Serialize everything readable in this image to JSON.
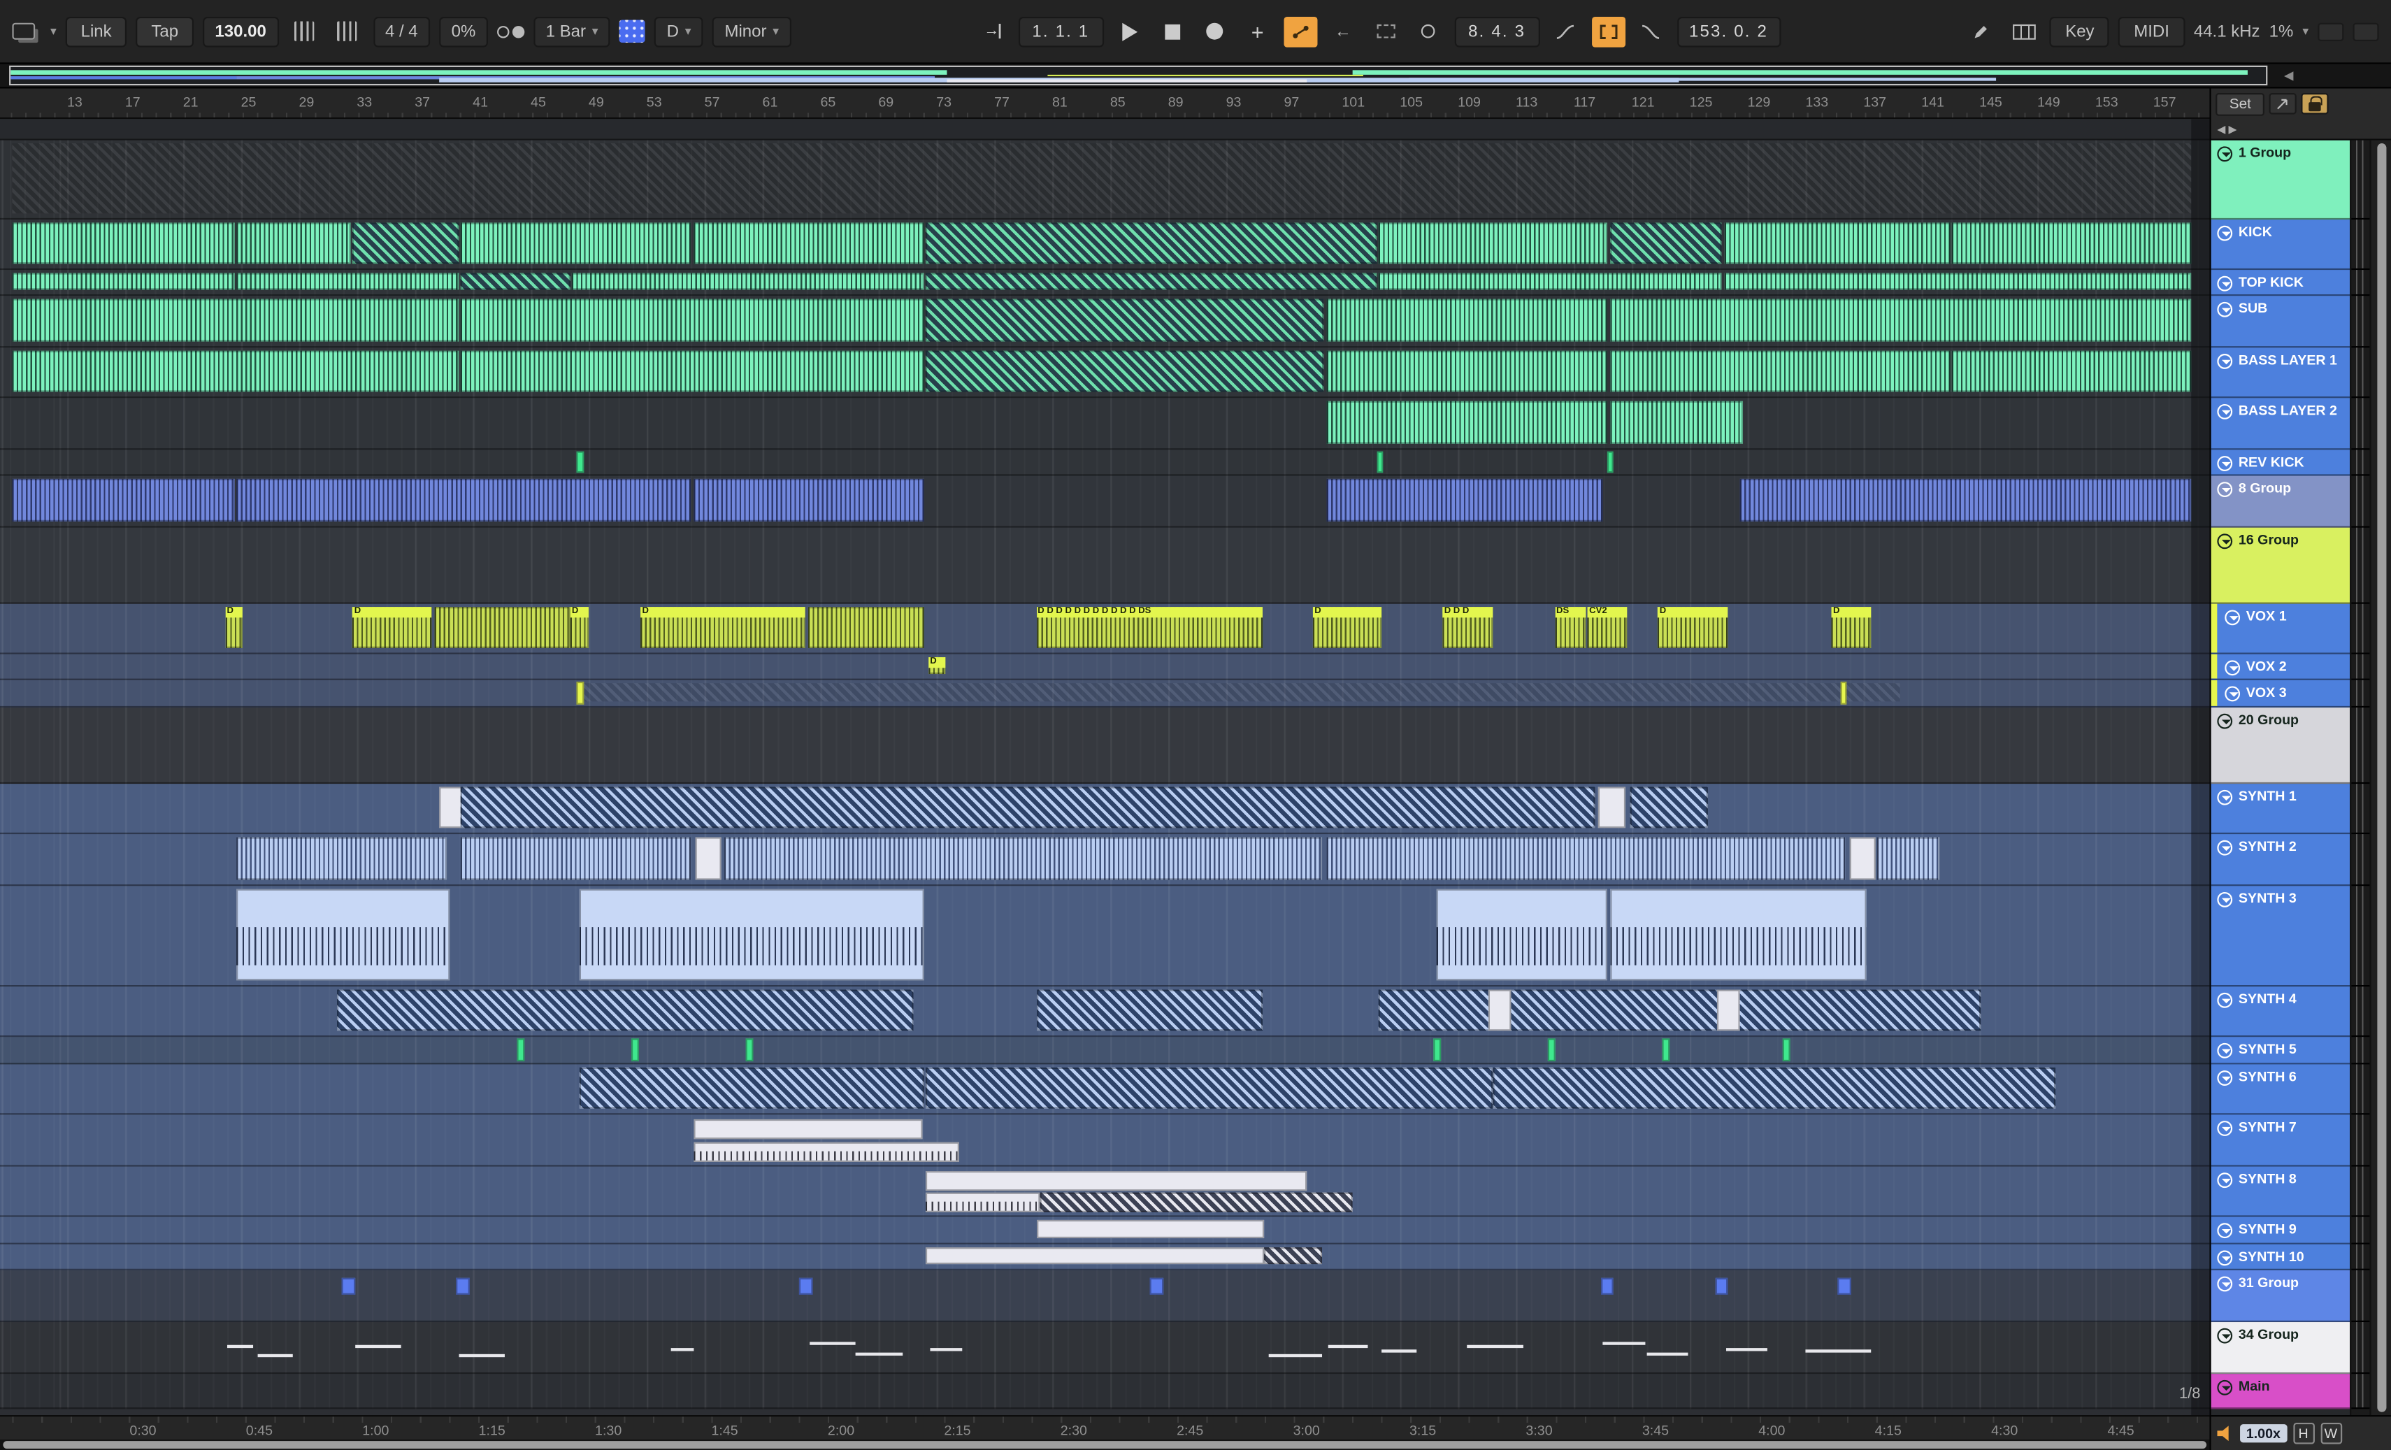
{
  "toolbar": {
    "link": "Link",
    "tap": "Tap",
    "tempo": "130.00",
    "time_signature": "4 / 4",
    "groove": "0%",
    "quantize": "1 Bar",
    "scale_root": "D",
    "scale_name": "Minor",
    "position": "1.  1.  1",
    "punch_time": "8.  4.  3",
    "loop_point": "153.  0.  2",
    "key": "Key",
    "midi": "MIDI",
    "sample_rate": "44.1 kHz",
    "cpu": "1%"
  },
  "ruler": {
    "set": "Set",
    "bars": [
      "13",
      "17",
      "21",
      "25",
      "29",
      "33",
      "37",
      "41",
      "45",
      "49",
      "53",
      "57",
      "61",
      "65",
      "69",
      "73",
      "77",
      "81",
      "85",
      "89",
      "93",
      "97",
      "101",
      "105",
      "109",
      "113",
      "117",
      "121",
      "125",
      "129",
      "133",
      "137",
      "141",
      "145",
      "149",
      "153",
      "157"
    ]
  },
  "time_ruler": {
    "labels": [
      "0:30",
      "0:45",
      "1:00",
      "1:15",
      "1:30",
      "1:45",
      "2:00",
      "2:15",
      "2:30",
      "2:45",
      "3:00",
      "3:15",
      "3:30",
      "3:45",
      "4:00",
      "4:15",
      "4:30",
      "4:45"
    ]
  },
  "status_bar": {
    "grid_value": "1/8",
    "speed": "1.00x",
    "h": "H",
    "w": "W"
  },
  "colors": {
    "accent_orange": "#f0a340",
    "mint": "#7df2be",
    "track_blue": "#4d80dd",
    "light_blue": "#b9cdf2",
    "vox_yellow": "#d9ee4e",
    "magenta": "#d84fc8"
  },
  "overview": {
    "segments": [
      {
        "s": 0,
        "w": 41.5,
        "y": 16,
        "h": 28,
        "c": "#7df2be"
      },
      {
        "s": 59.5,
        "w": 39.7,
        "y": 16,
        "h": 28,
        "c": "#7df2be"
      },
      {
        "s": 0,
        "w": 10,
        "y": 50,
        "h": 26,
        "c": "#5b7ce0"
      },
      {
        "s": 10,
        "w": 31,
        "y": 50,
        "h": 20,
        "c": "#6e86dd"
      },
      {
        "s": 46,
        "w": 14,
        "y": 44,
        "h": 12,
        "c": "#d8ee55"
      },
      {
        "s": 19,
        "w": 55,
        "y": 62,
        "h": 26,
        "c": "#b9cdf2"
      },
      {
        "s": 41.5,
        "w": 16,
        "y": 70,
        "h": 22,
        "c": "#e9e9f0"
      },
      {
        "s": 62,
        "w": 26,
        "y": 62,
        "h": 22,
        "c": "#b9cdf2"
      }
    ]
  },
  "tracks": [
    {
      "name": "1 Group",
      "kind": "group",
      "h": 52,
      "header": "#7ff0bd",
      "lane": "#2f3236",
      "dark": true,
      "clips": [
        {
          "t": "hatch-dark",
          "s": 0,
          "w": 99.2
        }
      ]
    },
    {
      "name": "KICK",
      "kind": "audio",
      "h": 33,
      "header": "#4d80dd",
      "lane": "#303439",
      "clips": [
        {
          "t": "wave-green",
          "s": 0,
          "w": 10.1
        },
        {
          "t": "wave-green",
          "s": 10.2,
          "w": 5.2
        },
        {
          "t": "hatch-green",
          "s": 15.5,
          "w": 4.8
        },
        {
          "t": "wave-green",
          "s": 20.4,
          "w": 10.5
        },
        {
          "t": "wave-green",
          "s": 31,
          "w": 10.5
        },
        {
          "t": "hatch-green",
          "s": 41.6,
          "w": 20.5
        },
        {
          "t": "wave-green",
          "s": 62.2,
          "w": 10.4
        },
        {
          "t": "hatch-green",
          "s": 72.7,
          "w": 5.1
        },
        {
          "t": "wave-green",
          "s": 77.9,
          "w": 10.3
        },
        {
          "t": "wave-green",
          "s": 88.3,
          "w": 10.9
        }
      ]
    },
    {
      "name": "TOP KICK",
      "kind": "audio",
      "h": 17,
      "header": "#4d80dd",
      "lane": "#303439",
      "clips": [
        {
          "t": "wave-green",
          "s": 0,
          "w": 10.1
        },
        {
          "t": "wave-green",
          "s": 10.2,
          "w": 10.1
        },
        {
          "t": "hatch-green",
          "s": 20.4,
          "w": 5
        },
        {
          "t": "wave-green",
          "s": 25.5,
          "w": 16
        },
        {
          "t": "hatch-green",
          "s": 41.6,
          "w": 20.5
        },
        {
          "t": "wave-green",
          "s": 62.2,
          "w": 15.6
        },
        {
          "t": "wave-green",
          "s": 77.9,
          "w": 21.3
        }
      ]
    },
    {
      "name": "SUB",
      "kind": "audio",
      "h": 34,
      "header": "#4d80dd",
      "lane": "#303439",
      "clips": [
        {
          "t": "wave-green",
          "s": 0,
          "w": 20.3
        },
        {
          "t": "wave-green",
          "s": 20.4,
          "w": 21.1
        },
        {
          "t": "hatch-green",
          "s": 41.6,
          "w": 18.1
        },
        {
          "t": "wave-green",
          "s": 59.8,
          "w": 12.8
        },
        {
          "t": "wave-green",
          "s": 72.7,
          "w": 26.5
        }
      ]
    },
    {
      "name": "BASS LAYER 1",
      "kind": "audio",
      "h": 33,
      "header": "#4d80dd",
      "lane": "#303439",
      "clips": [
        {
          "t": "wave-green",
          "s": 0,
          "w": 20.3
        },
        {
          "t": "wave-green",
          "s": 20.4,
          "w": 21.1
        },
        {
          "t": "hatch-green",
          "s": 41.6,
          "w": 18.1
        },
        {
          "t": "wave-green",
          "s": 59.8,
          "w": 12.8
        },
        {
          "t": "wave-green",
          "s": 72.7,
          "w": 15.5
        },
        {
          "t": "wave-green",
          "s": 88.3,
          "w": 10.9
        }
      ]
    },
    {
      "name": "BASS LAYER 2",
      "kind": "audio",
      "h": 34,
      "header": "#4d80dd",
      "lane": "#303439",
      "clips": [
        {
          "t": "wave-green",
          "s": 59.8,
          "w": 12.8
        },
        {
          "t": "wave-green",
          "s": 72.7,
          "w": 6.1
        }
      ]
    },
    {
      "name": "REV KICK",
      "kind": "audio",
      "h": 17,
      "header": "#4d80dd",
      "lane": "#303439",
      "clips": [
        {
          "t": "mark-green",
          "s": 25.7,
          "w": 0.3
        },
        {
          "t": "mark-green",
          "s": 62.1,
          "w": 0.3
        },
        {
          "t": "mark-green",
          "s": 72.6,
          "w": 0.3
        }
      ]
    },
    {
      "name": "8 Group",
      "kind": "group",
      "h": 34,
      "header": "#8393c6",
      "lane": "#31353b",
      "clips": [
        {
          "t": "wave-peri",
          "s": 0,
          "w": 10.1
        },
        {
          "t": "wave-peri",
          "s": 10.2,
          "w": 20.7
        },
        {
          "t": "wave-peri",
          "s": 31,
          "w": 10.5
        },
        {
          "t": "wave-peri",
          "s": 59.8,
          "w": 12.6
        },
        {
          "t": "wave-peri",
          "s": 78.6,
          "w": 20.6
        }
      ]
    },
    {
      "name": "16 Group",
      "kind": "group",
      "h": 50,
      "header": "#d9f060",
      "lane": "#34383e",
      "dark": true,
      "clips": []
    },
    {
      "name": "VOX 1",
      "kind": "audio",
      "h": 33,
      "header": "#4d80dd",
      "lane": "#46536f",
      "strip": true,
      "clips": [
        {
          "t": "vox",
          "s": 9.7,
          "w": 0.8,
          "label": "D"
        },
        {
          "t": "vox",
          "s": 15.5,
          "w": 3.6,
          "label": "D"
        },
        {
          "t": "vox",
          "s": 19.2,
          "w": 6.2
        },
        {
          "t": "vox",
          "s": 25.4,
          "w": 0.8,
          "label": "D"
        },
        {
          "t": "vox",
          "s": 28.6,
          "w": 7.5,
          "label": "D"
        },
        {
          "t": "vox",
          "s": 36.2,
          "w": 5.3
        },
        {
          "t": "vox",
          "s": 46.6,
          "w": 10.3,
          "label": "D D D D D D D D D D D DS"
        },
        {
          "t": "vox",
          "s": 59.2,
          "w": 3.1,
          "label": "D"
        },
        {
          "t": "vox",
          "s": 65.1,
          "w": 2.3,
          "label": "D D D"
        },
        {
          "t": "vox",
          "s": 70.2,
          "w": 1.4,
          "label": "DS"
        },
        {
          "t": "vox",
          "s": 71.7,
          "w": 1.8,
          "label": "CV2"
        },
        {
          "t": "vox",
          "s": 74.9,
          "w": 3.2,
          "label": "D"
        },
        {
          "t": "vox",
          "s": 82.8,
          "w": 1.8,
          "label": "D"
        }
      ]
    },
    {
      "name": "VOX 2",
      "kind": "audio",
      "h": 17,
      "header": "#4d80dd",
      "lane": "#46536f",
      "strip": true,
      "clips": [
        {
          "t": "vox",
          "s": 41.7,
          "w": 0.8,
          "label": "D"
        }
      ]
    },
    {
      "name": "VOX 3",
      "kind": "audio",
      "h": 18,
      "header": "#4d80dd",
      "lane": "#46536f",
      "strip": true,
      "clips": [
        {
          "t": "hatch-dark",
          "s": 25.7,
          "w": 60.2
        },
        {
          "t": "mark-yellow",
          "s": 25.7,
          "w": 0.3
        },
        {
          "t": "mark-yellow",
          "s": 83.2,
          "w": 0.3
        }
      ]
    },
    {
      "name": "20 Group",
      "kind": "group",
      "h": 50,
      "header": "#d6d6db",
      "lane": "#36393f",
      "dark": true,
      "clips": []
    },
    {
      "name": "SYNTH 1",
      "kind": "midi",
      "h": 33,
      "header": "#4d80dd",
      "lane": "#4b5d81",
      "clips": [
        {
          "t": "white",
          "s": 19.4,
          "w": 1.2
        },
        {
          "t": "hatch-lblue",
          "s": 20.4,
          "w": 51.6
        },
        {
          "t": "white",
          "s": 72.2,
          "w": 1.2
        },
        {
          "t": "hatch-lblue",
          "s": 73.6,
          "w": 3.6
        }
      ]
    },
    {
      "name": "SYNTH 2",
      "kind": "midi",
      "h": 34,
      "header": "#4d80dd",
      "lane": "#4b5d81",
      "clips": [
        {
          "t": "wave-lblue",
          "s": 10.2,
          "w": 9.6
        },
        {
          "t": "wave-lblue",
          "s": 20.4,
          "w": 10.5
        },
        {
          "t": "white",
          "s": 31.1,
          "w": 1.2
        },
        {
          "t": "wave-lblue",
          "s": 32.4,
          "w": 27.2
        },
        {
          "t": "wave-lblue",
          "s": 59.8,
          "w": 23.6
        },
        {
          "t": "white",
          "s": 83.6,
          "w": 1.2
        },
        {
          "t": "wave-lblue",
          "s": 84.9,
          "w": 2.8
        }
      ]
    },
    {
      "name": "SYNTH 3",
      "kind": "midi",
      "h": 66,
      "header": "#4d80dd",
      "lane": "#4b5d81",
      "clips": [
        {
          "t": "midi-lblue",
          "s": 10.2,
          "w": 9.7
        },
        {
          "t": "midi-lblue",
          "s": 25.8,
          "w": 15.7
        },
        {
          "t": "midi-lblue",
          "s": 64.8,
          "w": 7.8
        },
        {
          "t": "midi-lblue",
          "s": 72.7,
          "w": 11.7
        }
      ]
    },
    {
      "name": "SYNTH 4",
      "kind": "midi",
      "h": 33,
      "header": "#4d80dd",
      "lane": "#4b5d81",
      "clips": [
        {
          "t": "hatch-lblue",
          "s": 14.8,
          "w": 26.2
        },
        {
          "t": "hatch-lblue",
          "s": 46.6,
          "w": 10.3
        },
        {
          "t": "hatch-lblue",
          "s": 62.2,
          "w": 27.4
        },
        {
          "t": "white",
          "s": 67.2,
          "w": 1
        },
        {
          "t": "white",
          "s": 77.6,
          "w": 1
        }
      ]
    },
    {
      "name": "SYNTH 5",
      "kind": "midi",
      "h": 18,
      "header": "#4d80dd",
      "lane": "#44546f",
      "clips": [
        {
          "t": "mark-green",
          "s": 23,
          "w": 0.3
        },
        {
          "t": "mark-green",
          "s": 28.2,
          "w": 0.3
        },
        {
          "t": "mark-green",
          "s": 33.4,
          "w": 0.3
        },
        {
          "t": "mark-green",
          "s": 64.7,
          "w": 0.3
        },
        {
          "t": "mark-green",
          "s": 69.9,
          "w": 0.3
        },
        {
          "t": "mark-green",
          "s": 75.1,
          "w": 0.3
        },
        {
          "t": "mark-green",
          "s": 80.6,
          "w": 0.3
        }
      ]
    },
    {
      "name": "SYNTH 6",
      "kind": "midi",
      "h": 33,
      "header": "#4d80dd",
      "lane": "#4b5d81",
      "clips": [
        {
          "t": "hatch-lblue",
          "s": 25.8,
          "w": 15.7
        },
        {
          "t": "hatch-lblue",
          "s": 41.6,
          "w": 25.8
        },
        {
          "t": "hatch-lblue",
          "s": 67.4,
          "w": 25.6
        }
      ]
    },
    {
      "name": "SYNTH 7",
      "kind": "midi",
      "h": 34,
      "header": "#4d80dd",
      "lane": "#4b5d81",
      "clips": [
        {
          "t": "white",
          "s": 31,
          "w": 10.4,
          "lane": "top"
        },
        {
          "t": "midi-white",
          "s": 31,
          "w": 12.1,
          "lane": "bottom"
        }
      ]
    },
    {
      "name": "SYNTH 8",
      "kind": "midi",
      "h": 33,
      "header": "#4d80dd",
      "lane": "#4b5d81",
      "clips": [
        {
          "t": "white",
          "s": 41.6,
          "w": 17.3,
          "lane": "top"
        },
        {
          "t": "midi-white",
          "s": 41.6,
          "w": 5.2,
          "lane": "bottom"
        },
        {
          "t": "hatch-white",
          "s": 46.8,
          "w": 14.2,
          "lane": "bottom"
        }
      ]
    },
    {
      "name": "SYNTH 9",
      "kind": "midi",
      "h": 18,
      "header": "#4d80dd",
      "lane": "#4b5d81",
      "clips": [
        {
          "t": "white",
          "s": 46.6,
          "w": 10.4
        }
      ]
    },
    {
      "name": "SYNTH 10",
      "kind": "midi",
      "h": 17,
      "header": "#4d80dd",
      "lane": "#4b5d81",
      "clips": [
        {
          "t": "white",
          "s": 41.6,
          "w": 15.4
        },
        {
          "t": "hatch-white",
          "s": 57,
          "w": 2.6
        }
      ]
    },
    {
      "name": "31 Group",
      "kind": "group",
      "h": 34,
      "header": "#5e86e6",
      "lane": "#3a4150",
      "clips": [
        {
          "t": "mark-blue",
          "s": 15,
          "w": 0.6
        },
        {
          "t": "mark-blue",
          "s": 20.2,
          "w": 0.6
        },
        {
          "t": "mark-blue",
          "s": 35.8,
          "w": 0.6
        },
        {
          "t": "mark-blue",
          "s": 51.8,
          "w": 0.6
        },
        {
          "t": "mark-blue",
          "s": 72.3,
          "w": 0.6
        },
        {
          "t": "mark-blue",
          "s": 77.5,
          "w": 0.6
        },
        {
          "t": "mark-blue",
          "s": 83.1,
          "w": 0.6
        }
      ]
    },
    {
      "name": "34 Group",
      "kind": "group",
      "h": 34,
      "header": "#efeff2",
      "lane": "#303338",
      "dark": true,
      "clips": [
        {
          "t": "dash",
          "s": 9.8,
          "w": 1.2,
          "y": 45
        },
        {
          "t": "dash",
          "s": 11.2,
          "w": 1.6,
          "y": 65
        },
        {
          "t": "dash",
          "s": 15.6,
          "w": 2.1,
          "y": 45
        },
        {
          "t": "dash",
          "s": 20.3,
          "w": 2.1,
          "y": 65
        },
        {
          "t": "dash",
          "s": 30,
          "w": 1,
          "y": 50
        },
        {
          "t": "dash",
          "s": 36.3,
          "w": 2.1,
          "y": 40
        },
        {
          "t": "dash",
          "s": 38.4,
          "w": 2.1,
          "y": 60
        },
        {
          "t": "dash",
          "s": 41.8,
          "w": 1.4,
          "y": 50
        },
        {
          "t": "dash",
          "s": 57.2,
          "w": 2.4,
          "y": 65
        },
        {
          "t": "dash",
          "s": 59.9,
          "w": 1.8,
          "y": 45
        },
        {
          "t": "dash",
          "s": 62.3,
          "w": 1.6,
          "y": 55
        },
        {
          "t": "dash",
          "s": 66.2,
          "w": 2.6,
          "y": 45
        },
        {
          "t": "dash",
          "s": 72.4,
          "w": 1.9,
          "y": 40
        },
        {
          "t": "dash",
          "s": 74.4,
          "w": 1.9,
          "y": 60
        },
        {
          "t": "dash",
          "s": 78,
          "w": 1.9,
          "y": 50
        },
        {
          "t": "dash",
          "s": 81.6,
          "w": 3,
          "y": 55
        }
      ]
    },
    {
      "name": "Main",
      "kind": "main",
      "h": 23,
      "header": "#d84fc8",
      "lane": "#2c2f34",
      "dark": true,
      "clips": []
    }
  ]
}
